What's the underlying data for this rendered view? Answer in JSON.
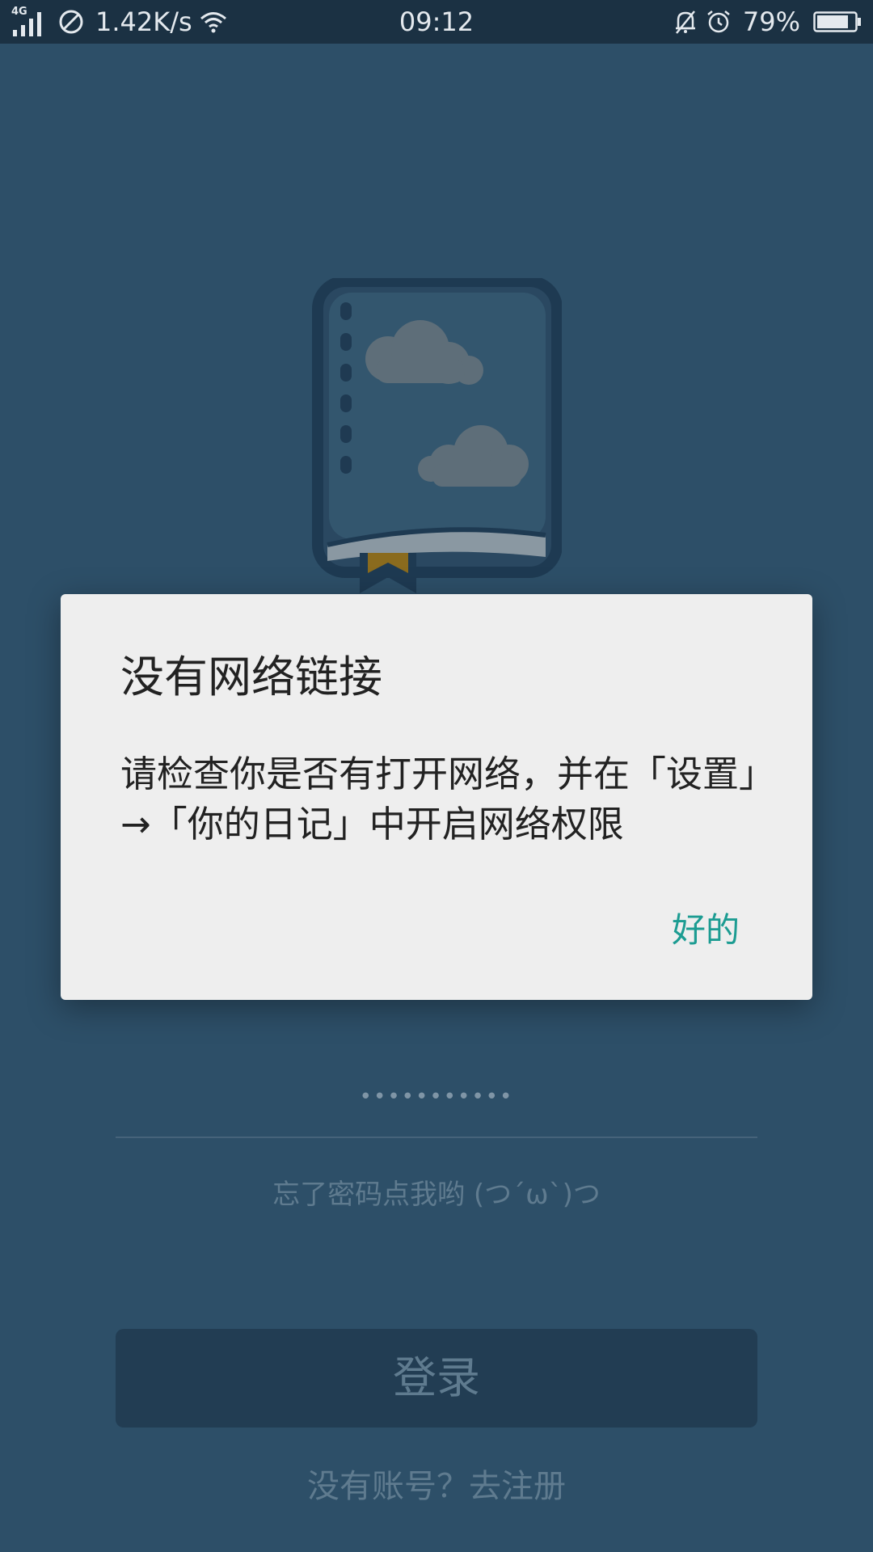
{
  "status_bar": {
    "network_type": "4G",
    "speed": "1.42K/s",
    "time": "09:12",
    "battery": "79%"
  },
  "login": {
    "password_mask": "•••••••••••",
    "forgot_password": "忘了密码点我哟 (つ´ω`)つ",
    "login_button": "登录",
    "register_link": "没有账号？去注册"
  },
  "dialog": {
    "title": "没有网络链接",
    "message": "请检查你是否有打开网络，并在「设置」→「你的日记」中开启网络权限",
    "ok_button": "好的"
  },
  "colors": {
    "background": "#2d4f68",
    "status_bar": "#1b3143",
    "dialog_bg": "#eeeeee",
    "accent": "#1c9c92"
  }
}
